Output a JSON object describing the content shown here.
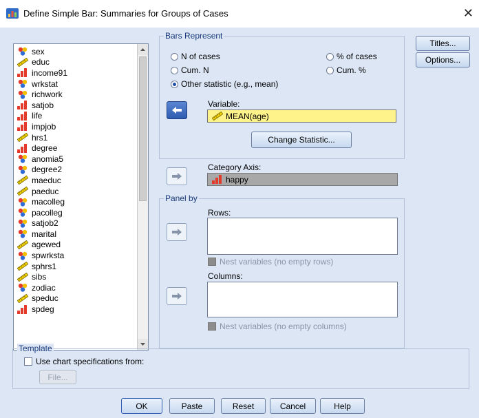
{
  "window": {
    "title": "Define Simple Bar: Summaries for Groups of Cases",
    "close_glyph": "✕"
  },
  "variables": [
    {
      "name": "sex",
      "icon": "nominal-icon"
    },
    {
      "name": "educ",
      "icon": "scale-icon"
    },
    {
      "name": "income91",
      "icon": "ordinal-icon"
    },
    {
      "name": "wrkstat",
      "icon": "nominal-icon"
    },
    {
      "name": "richwork",
      "icon": "nominal-icon"
    },
    {
      "name": "satjob",
      "icon": "ordinal-icon"
    },
    {
      "name": "life",
      "icon": "ordinal-icon"
    },
    {
      "name": "impjob",
      "icon": "ordinal-icon"
    },
    {
      "name": "hrs1",
      "icon": "scale-icon"
    },
    {
      "name": "degree",
      "icon": "ordinal-icon"
    },
    {
      "name": "anomia5",
      "icon": "nominal-icon"
    },
    {
      "name": "degree2",
      "icon": "nominal-icon"
    },
    {
      "name": "maeduc",
      "icon": "scale-icon"
    },
    {
      "name": "paeduc",
      "icon": "scale-icon"
    },
    {
      "name": "macolleg",
      "icon": "nominal-icon"
    },
    {
      "name": "pacolleg",
      "icon": "nominal-icon"
    },
    {
      "name": "satjob2",
      "icon": "nominal-icon"
    },
    {
      "name": "marital",
      "icon": "nominal-icon"
    },
    {
      "name": "agewed",
      "icon": "scale-icon"
    },
    {
      "name": "spwrksta",
      "icon": "nominal-icon"
    },
    {
      "name": "sphrs1",
      "icon": "scale-icon"
    },
    {
      "name": "sibs",
      "icon": "scale-icon"
    },
    {
      "name": "zodiac",
      "icon": "nominal-icon"
    },
    {
      "name": "speduc",
      "icon": "scale-icon"
    },
    {
      "name": "spdeg",
      "icon": "ordinal-icon"
    }
  ],
  "bars_represent": {
    "legend": "Bars Represent",
    "n_of_cases": "N of cases",
    "pct_of_cases": "% of cases",
    "cum_n": "Cum. N",
    "cum_pct": "Cum. %",
    "other_statistic": "Other statistic (e.g., mean)",
    "selected": "other_statistic",
    "variable_label": "Variable:",
    "variable_value": "MEAN(age)",
    "change_statistic": "Change Statistic..."
  },
  "category_axis": {
    "label": "Category Axis:",
    "value": "happy"
  },
  "panel_by": {
    "legend": "Panel by",
    "rows_label": "Rows:",
    "nest_rows": "Nest variables (no empty rows)",
    "columns_label": "Columns:",
    "nest_columns": "Nest variables (no empty columns)"
  },
  "side_buttons": {
    "titles": "Titles...",
    "options": "Options..."
  },
  "template": {
    "legend": "Template",
    "use_chart_specs": "Use chart specifications from:",
    "file_button": "File..."
  },
  "footer": {
    "ok": "OK",
    "paste": "Paste",
    "reset": "Reset",
    "cancel": "Cancel",
    "help": "Help"
  }
}
